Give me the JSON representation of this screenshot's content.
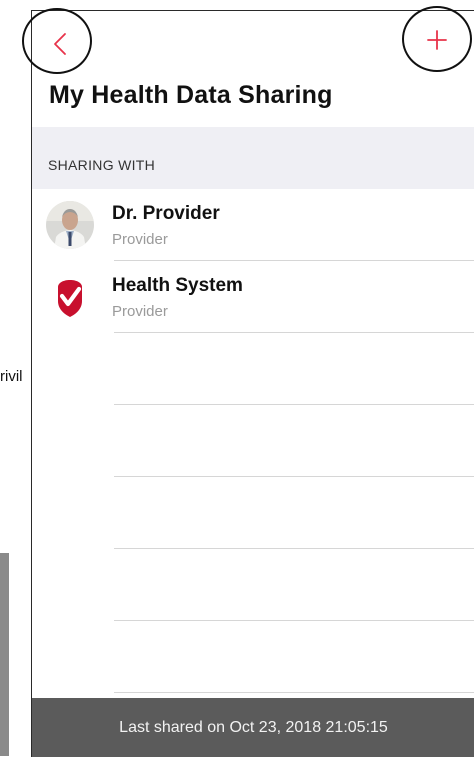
{
  "background_fragment": {
    "text": "rivil"
  },
  "nav": {
    "back_icon": "chevron-left-icon",
    "add_icon": "plus-icon",
    "accent_color": "#e8334a"
  },
  "page": {
    "title": "My Health Data Sharing"
  },
  "section": {
    "title": "SHARING WITH"
  },
  "recipients": [
    {
      "name": "Dr. Provider",
      "role": "Provider",
      "avatar": "doctor-photo"
    },
    {
      "name": "Health System",
      "role": "Provider",
      "avatar": "health-system-logo-icon"
    }
  ],
  "footer": {
    "last_shared": "Last shared on Oct 23, 2018 21:05:15"
  },
  "colors": {
    "section_bg": "#efeff4",
    "footer_bg": "#5b5b5b",
    "logo_red": "#c8102e"
  }
}
